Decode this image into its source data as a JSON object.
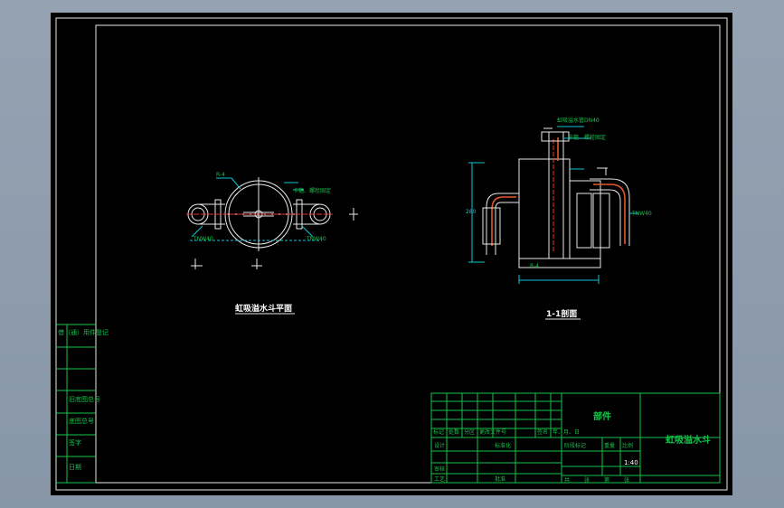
{
  "plan_view": {
    "title": "虹吸溢水斗平面",
    "radius_label": "R-4",
    "callout": "卡箍、螺栓固定",
    "pipe_label_left": "TNW40",
    "pipe_label_right": "TNW40"
  },
  "section_view": {
    "title": "1-1剖面",
    "top_callout": "虹吸溢水管DN40",
    "callout": "卡箍、螺栓固定",
    "pipe_label": "TNW40",
    "dim_left": "280",
    "base_label": "R-4"
  },
  "title_block": {
    "part_label": "部件",
    "drawing_name": "虹吸溢水斗",
    "scale": "1:40",
    "row_labels": [
      "标记",
      "处数",
      "分区",
      "更改文件号",
      "签名",
      "年、月、日"
    ],
    "design_label": "设计",
    "standard_label": "标准化",
    "review_label": "审核",
    "craft_label": "工艺",
    "approve_label": "批准",
    "stage_headers": [
      "阶段标记",
      "重量",
      "比例"
    ],
    "sheet_labels": [
      "共",
      "张",
      "第",
      "张"
    ]
  },
  "side_panel": {
    "labels": [
      "借（通）用件登记",
      "",
      "旧底图总号",
      "底图总号",
      "签字",
      "日期"
    ]
  }
}
